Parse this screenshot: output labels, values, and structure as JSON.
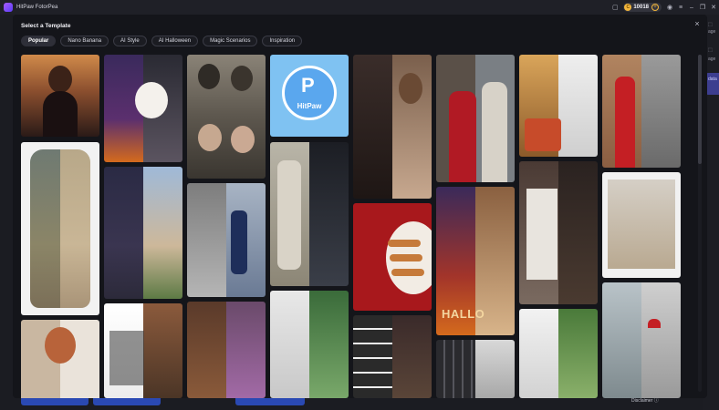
{
  "app": {
    "title": "HitPaw FotorPea"
  },
  "titlebar": {
    "credits": "10018"
  },
  "sidebar_right": {
    "item_a": "age",
    "item_b": "age",
    "item_c": "data"
  },
  "footer": {
    "disclaimer": "Disclaimer ⓘ"
  },
  "modal": {
    "title": "Select a Template",
    "close": "×",
    "tabs": [
      "Popular",
      "Nano Banana",
      "AI Style",
      "AI Halloween",
      "Magic Scenarios",
      "Inspiration"
    ],
    "active_tab": "Popular"
  },
  "cards": {
    "hitpaw_card_text": "HitPaw",
    "halloween_card_text": "HALLO"
  },
  "colors": {
    "accent": "#2a49b3",
    "coin": "#f2b63c",
    "hitpaw_blue": "#5aa7ee"
  }
}
